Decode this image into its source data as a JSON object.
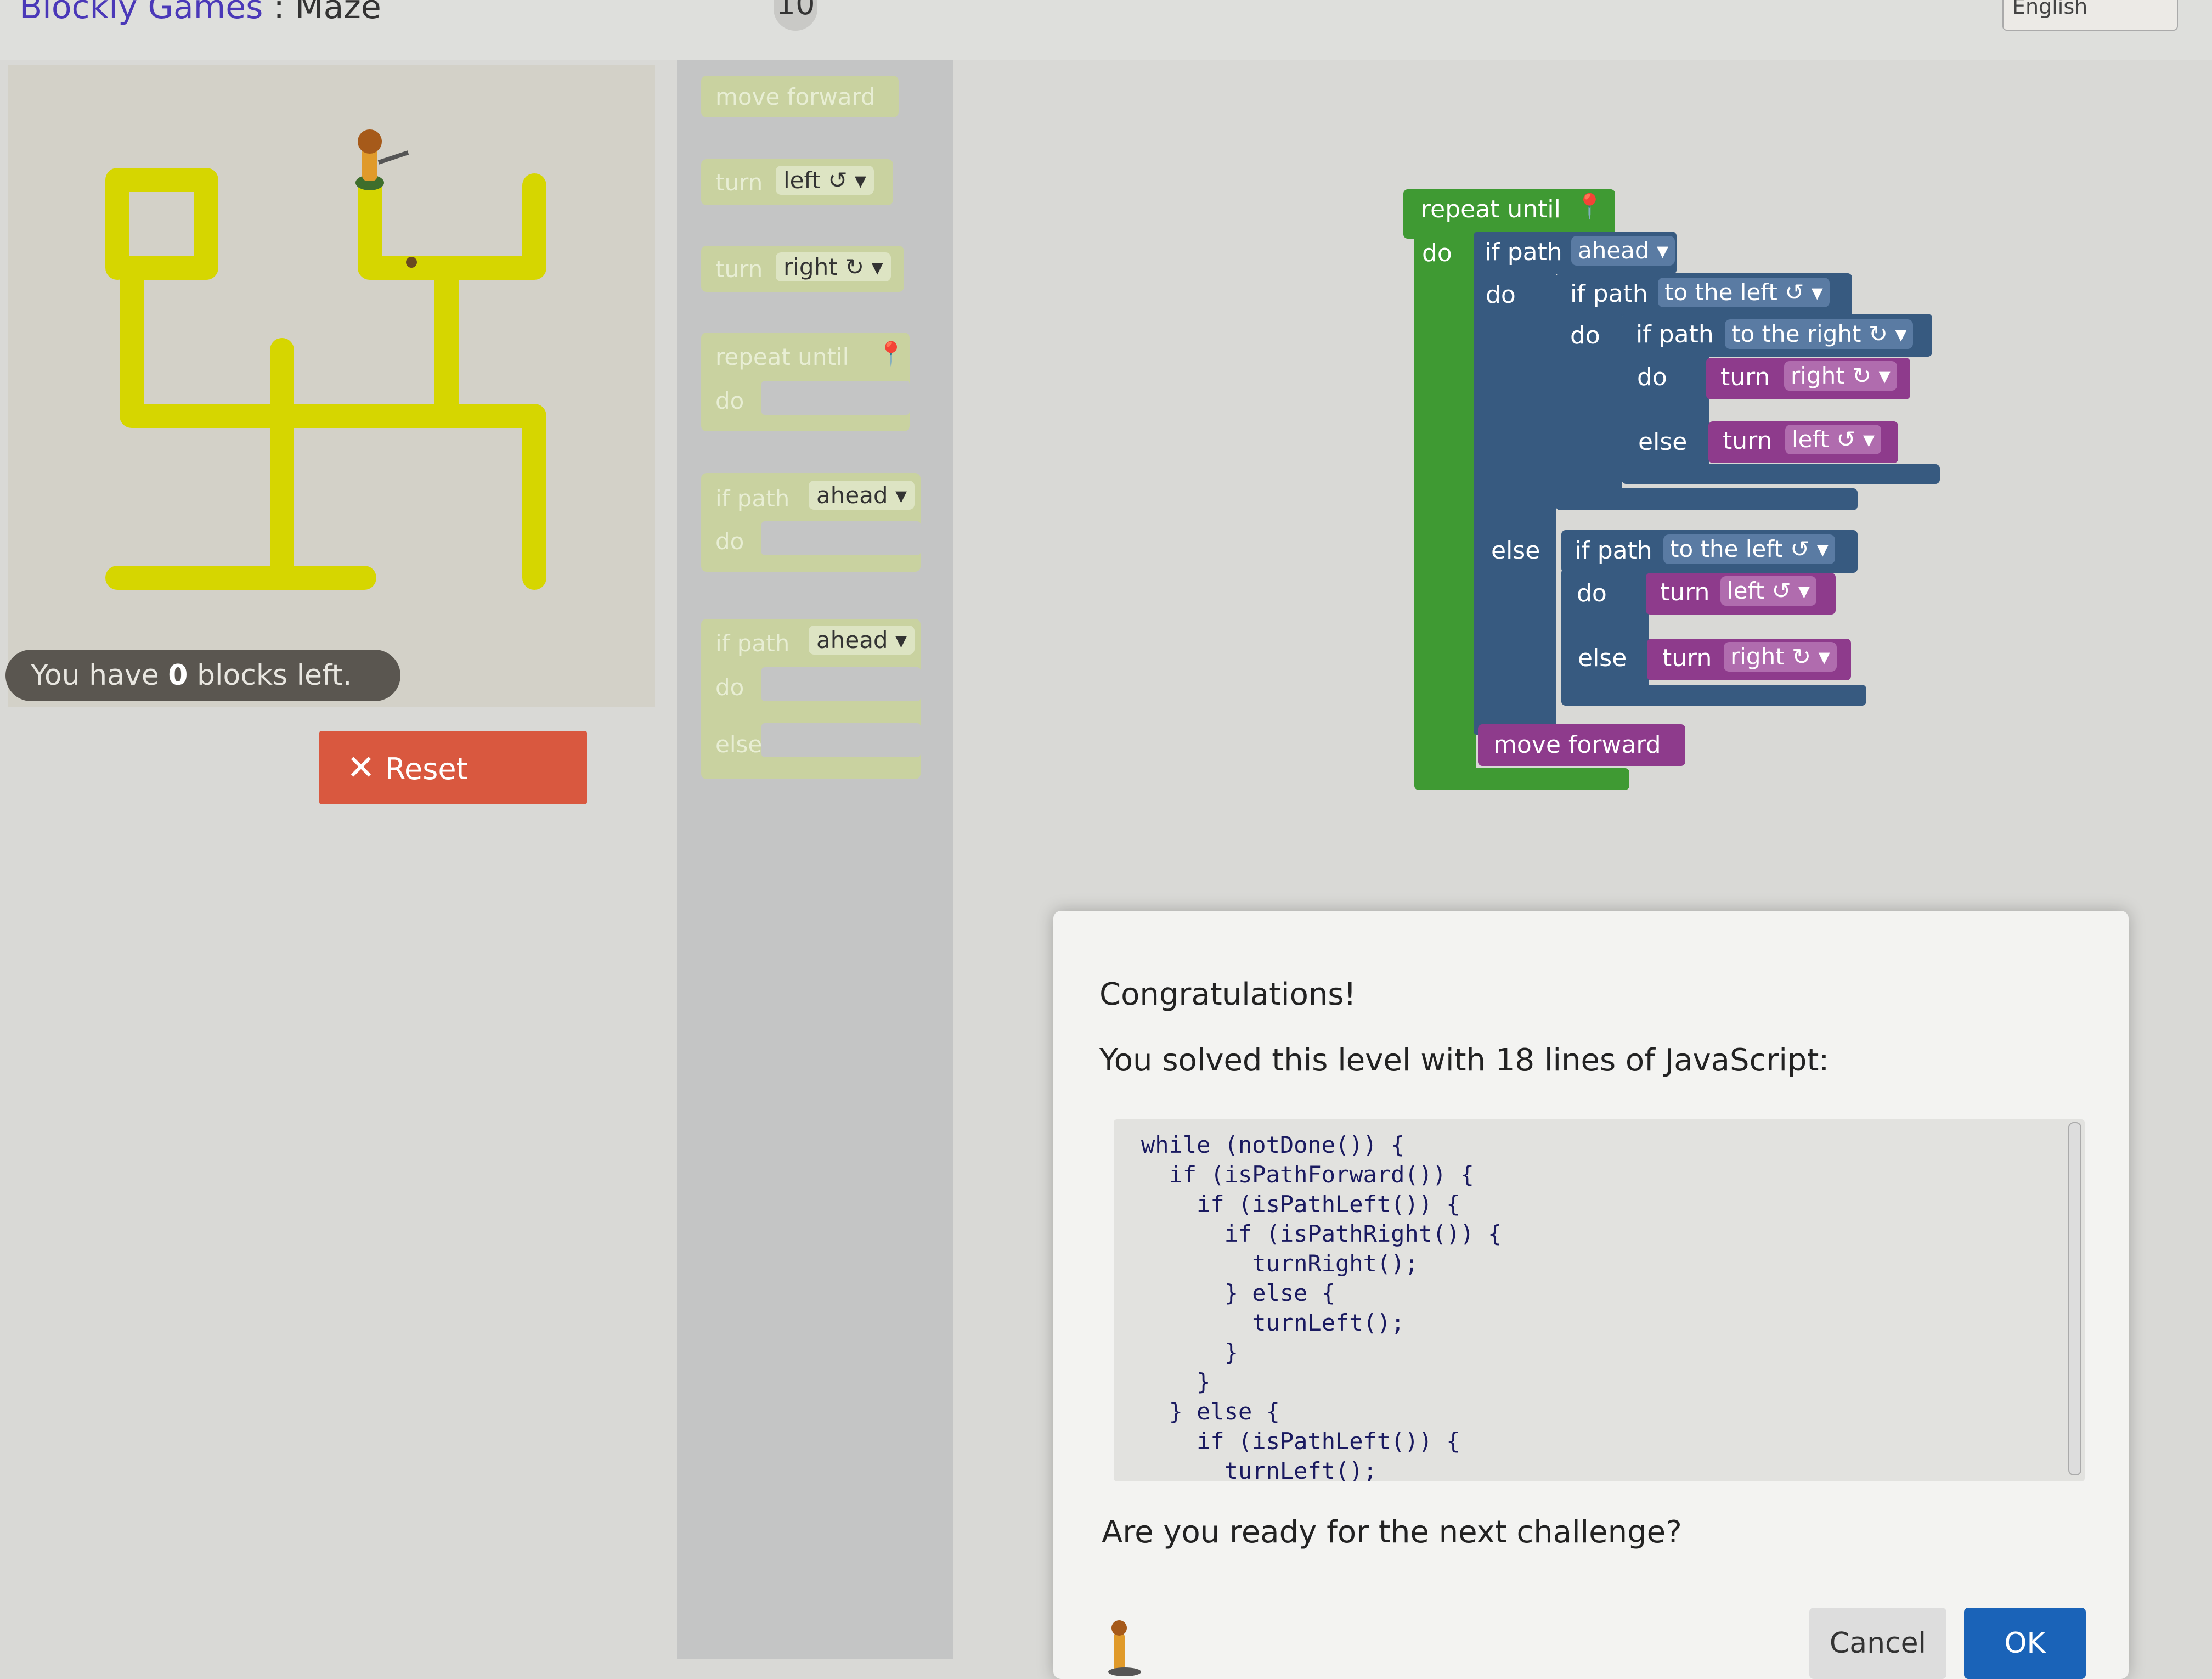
{
  "header": {
    "brand": "Blockly Games",
    "separator": ":",
    "page": "Maze",
    "level": "10",
    "language": "English"
  },
  "maze": {
    "capacity_prefix": "You have ",
    "capacity_count": "0",
    "capacity_suffix": " blocks left.",
    "path_color": "#d6d600",
    "reset_label": "Reset"
  },
  "toolbox": {
    "move_forward": "move forward",
    "turn": "turn",
    "left": "left ↺ ▾",
    "right": "right ↻ ▾",
    "repeat_until": "repeat until",
    "do": "do",
    "if_path": "if path",
    "ahead": "ahead ▾",
    "else": "else"
  },
  "workspace": {
    "repeat_until": "repeat until",
    "do": "do",
    "else": "else",
    "if_path": "if path",
    "ahead": "ahead ▾",
    "to_the_left": "to the left ↺ ▾",
    "to_the_right": "to the right ↻ ▾",
    "turn": "turn",
    "right": "right ↻ ▾",
    "left": "left ↺ ▾",
    "move_forward": "move forward"
  },
  "dialog": {
    "title": "Congratulations!",
    "summary": "You solved this level with 18 lines of JavaScript:",
    "code": "while (notDone()) {\n  if (isPathForward()) {\n    if (isPathLeft()) {\n      if (isPathRight()) {\n        turnRight();\n      } else {\n        turnLeft();\n      }\n    }\n  } else {\n    if (isPathLeft()) {\n      turnLeft();",
    "question": "Are you ready for the next challenge?",
    "cancel_label": "Cancel",
    "ok_label": "OK"
  }
}
